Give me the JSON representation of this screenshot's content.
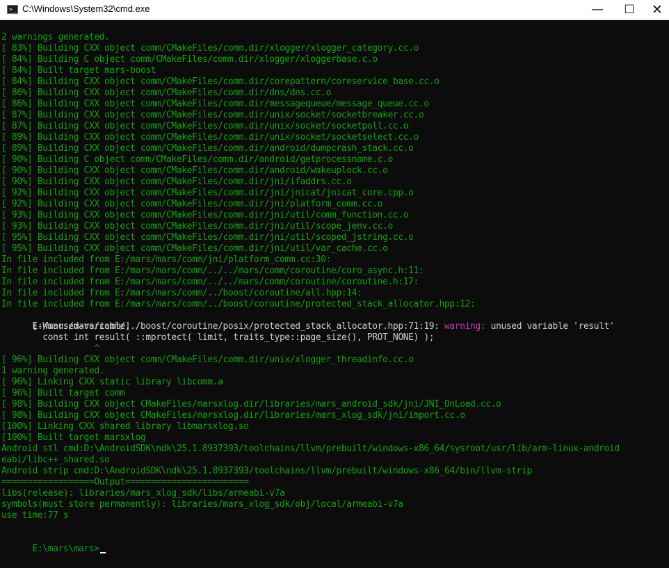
{
  "window": {
    "title": "C:\\Windows\\System32\\cmd.exe",
    "controls": {
      "minimize": "—",
      "maximize": "☐",
      "close": "✕"
    }
  },
  "terminal": {
    "top_fragment": "^",
    "lines": [
      "2 warnings generated.",
      "[ 83%] Building CXX object comm/CMakeFiles/comm.dir/xlogger/xlogger_category.cc.o",
      "[ 84%] Building C object comm/CMakeFiles/comm.dir/xlogger/xloggerbase.c.o",
      "[ 84%] Built target mars-boost",
      "[ 84%] Building CXX object comm/CMakeFiles/comm.dir/corepattern/coreservice_base.cc.o",
      "[ 86%] Building CXX object comm/CMakeFiles/comm.dir/dns/dns.cc.o",
      "[ 86%] Building CXX object comm/CMakeFiles/comm.dir/messagequeue/message_queue.cc.o",
      "[ 87%] Building CXX object comm/CMakeFiles/comm.dir/unix/socket/socketbreaker.cc.o",
      "[ 87%] Building CXX object comm/CMakeFiles/comm.dir/unix/socket/socketpoll.cc.o",
      "[ 89%] Building CXX object comm/CMakeFiles/comm.dir/unix/socket/socketselect.cc.o",
      "[ 89%] Building CXX object comm/CMakeFiles/comm.dir/android/dumpcrash_stack.cc.o",
      "[ 90%] Building C object comm/CMakeFiles/comm.dir/android/getprocessname.c.o",
      "[ 90%] Building CXX object comm/CMakeFiles/comm.dir/android/wakeuplock.cc.o",
      "[ 90%] Building CXX object comm/CMakeFiles/comm.dir/jni/ifaddrs.cc.o",
      "[ 92%] Building CXX object comm/CMakeFiles/comm.dir/jni/jnicat/jnicat_core.cpp.o",
      "[ 92%] Building CXX object comm/CMakeFiles/comm.dir/jni/platform_comm.cc.o",
      "[ 93%] Building CXX object comm/CMakeFiles/comm.dir/jni/util/comm_function.cc.o",
      "[ 93%] Building CXX object comm/CMakeFiles/comm.dir/jni/util/scope_jenv.cc.o",
      "[ 95%] Building CXX object comm/CMakeFiles/comm.dir/jni/util/scoped_jstring.cc.o",
      "[ 95%] Building CXX object comm/CMakeFiles/comm.dir/jni/util/var_cache.cc.o",
      "In file included from E:/mars/mars/comm/jni/platform_comm.cc:30:",
      "In file included from E:/mars/mars/comm/../../mars/comm/coroutine/coro_async.h:11:",
      "In file included from E:/mars/mars/comm/../../mars/comm/coroutine/coroutine.h:17:",
      "In file included from E:/mars/mars/comm/../boost/coroutine/all.hpp:14:",
      "In file included from E:/mars/mars/comm/../boost/coroutine/protected_stack_allocator.hpp:12:"
    ],
    "warning_line": {
      "prefix": "E:/mars/mars/comm/../boost/coroutine/posix/protected_stack_allocator.hpp:71:19: ",
      "label": "warning:",
      "message": " unused variable 'result'"
    },
    "flag_line": "      [-Wunused-variable]",
    "code_line": "        const int result( ::mprotect( limit, traits_type::page_size(), PROT_NONE) );",
    "caret_line": "                  ^",
    "blank_line": "",
    "lines_after": [
      "[ 96%] Building CXX object comm/CMakeFiles/comm.dir/unix/xlogger_threadinfo.cc.o",
      "1 warning generated.",
      "[ 96%] Linking CXX static library libcomm.a",
      "[ 96%] Built target comm",
      "[ 98%] Building CXX object CMakeFiles/marsxlog.dir/libraries/mars_android_sdk/jni/JNI_OnLoad.cc.o",
      "[ 98%] Building CXX object CMakeFiles/marsxlog.dir/libraries/mars_xlog_sdk/jni/import.cc.o",
      "[100%] Linking CXX shared library libmarsxlog.so",
      "[100%] Built target marsxlog",
      "Android stl cmd:D:\\AndroidSDK\\ndk\\25.1.8937393/toolchains/llvm/prebuilt/windows-x86_64/sysroot/usr/lib/arm-linux-android",
      "eabi/libc++_shared.so",
      "Android strip cmd:D:\\AndroidSDK\\ndk\\25.1.8937393/toolchains/llvm/prebuilt/windows-x86_64/bin/llvm-strip",
      "==================Output========================",
      "libs(release): libraries/mars_xlog_sdk/libs/armeabi-v7a",
      "symbols(must store permanently): libraries/mars_xlog_sdk/obj/local/armeabi-v7a",
      "use time:77 s",
      "",
      "E:\\mars\\mars>"
    ]
  },
  "colors": {
    "terminal_bg": "#0c0c0c",
    "text_green": "#13a10e",
    "text_white": "#cccccc",
    "warning_magenta": "#c239b3",
    "titlebar_bg": "#ffffff"
  },
  "icons": {
    "app": "console-icon",
    "minimize": "minimize-icon",
    "maximize": "maximize-icon",
    "close": "close-icon",
    "cursor": "text-cursor-icon"
  }
}
